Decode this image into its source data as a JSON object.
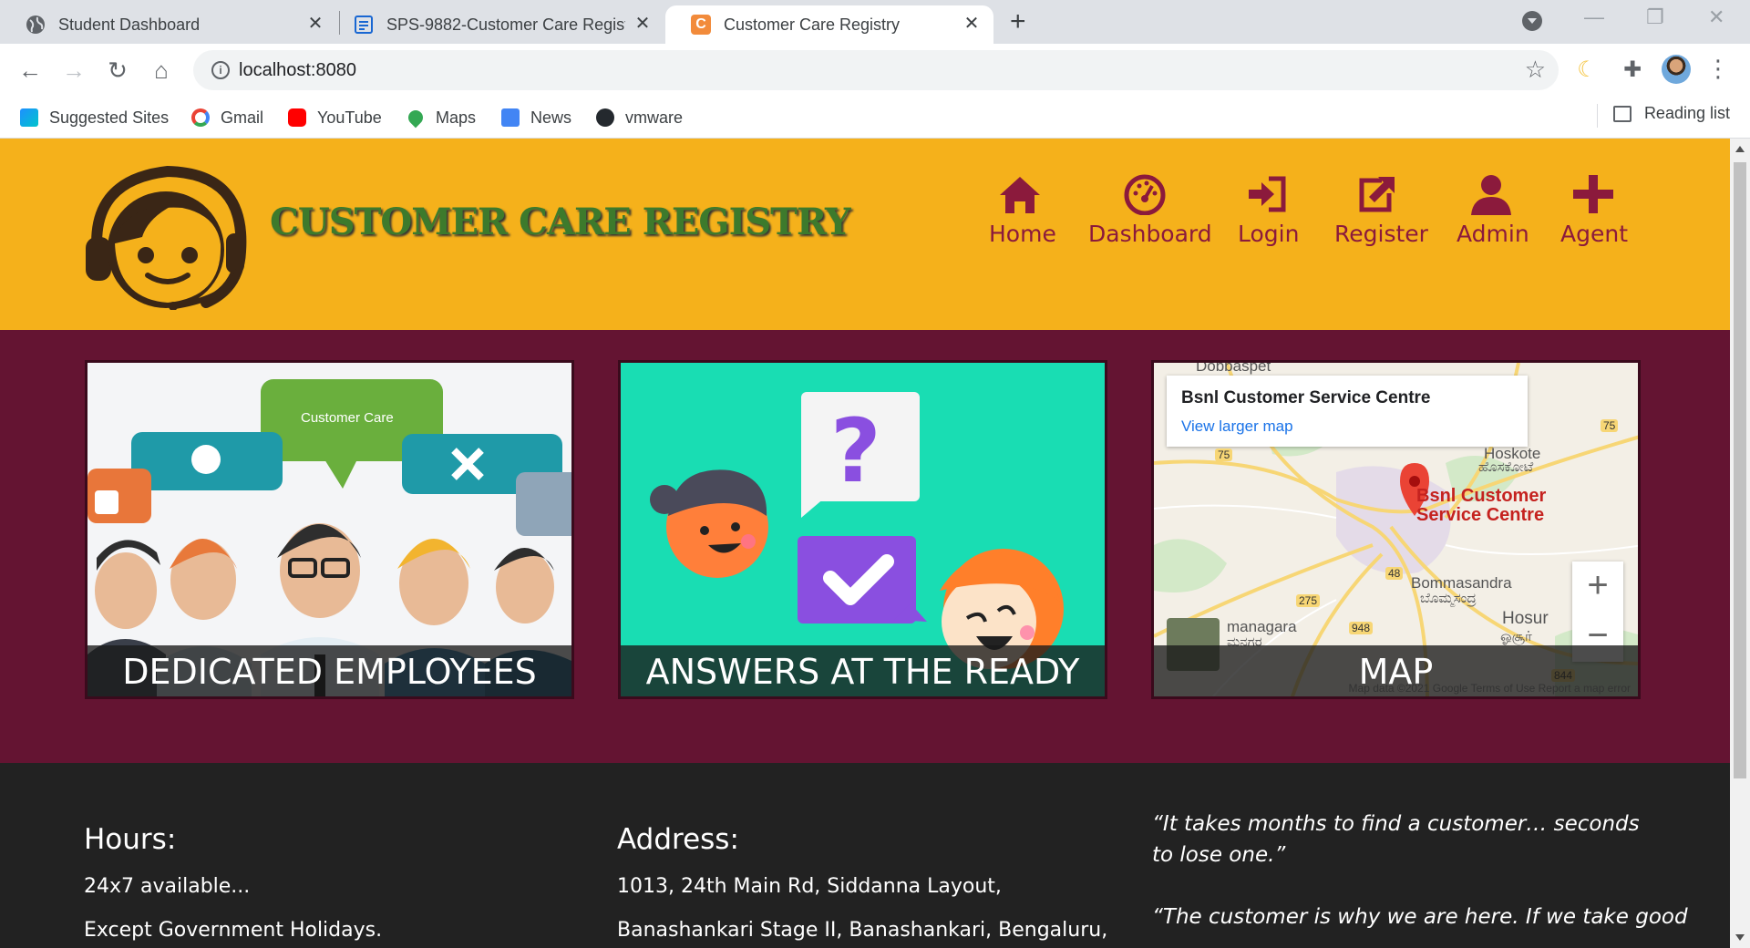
{
  "browser": {
    "tabs": [
      {
        "title": "Student Dashboard",
        "active": false
      },
      {
        "title": "SPS-9882-Customer Care Registr",
        "active": false
      },
      {
        "title": "Customer Care Registry",
        "active": true
      }
    ],
    "url": "localhost:8080",
    "bookmarks": [
      "Suggested Sites",
      "Gmail",
      "YouTube",
      "Maps",
      "News",
      "vmware"
    ],
    "reading_list": "Reading list"
  },
  "site": {
    "brand": "CUSTOMER CARE REGISTRY",
    "nav": [
      "Home",
      "Dashboard",
      "Login",
      "Register",
      "Admin",
      "Agent"
    ],
    "colors": {
      "header": "#f5b11b",
      "accent": "#8b1a3c",
      "band": "#641432",
      "footer": "#222222"
    }
  },
  "features": [
    {
      "caption": "DEDICATED EMPLOYEES",
      "bubble_text": "Customer Care"
    },
    {
      "caption": "ANSWERS AT THE READY"
    },
    {
      "caption": "MAP"
    }
  ],
  "map": {
    "place_title": "Bsnl Customer Service Centre",
    "link": "View larger map",
    "pin_label_1": "Bsnl Customer",
    "pin_label_2": "Service Centre",
    "labels": {
      "doddaspet": "Dobbaspet",
      "hoskote": "Hoskote",
      "hoskote_kn": "ಹೊಸಕೋಟೆ",
      "bommasandra": "Bommasandra",
      "bommasandra_kn": "ಬೊಮ್ಮಸಂದ್ರ",
      "hosur": "Hosur",
      "hosur_ta": "ஓசூர்",
      "ramanagara": "managara",
      "ramanagara_kn": "ಮನಗರ",
      "road_75a": "75",
      "road_75b": "75",
      "road_48": "48",
      "road_275": "275",
      "road_948": "948",
      "road_844": "844"
    },
    "footer": "Map data ©2021 Google    Terms of Use    Report a map error"
  },
  "footer": {
    "hours_title": "Hours:",
    "hours_line1": "24x7 available...",
    "hours_line2": "Except Government Holidays.",
    "address_title": "Address:",
    "address_line1": "1013, 24th Main Rd, Siddanna Layout,",
    "address_line2": "Banashankari Stage II, Banashankari, Bengaluru,",
    "quote1": "“It takes months to find a customer… seconds to lose one.”",
    "quote2": "“The customer is why we are here. If we take good"
  }
}
